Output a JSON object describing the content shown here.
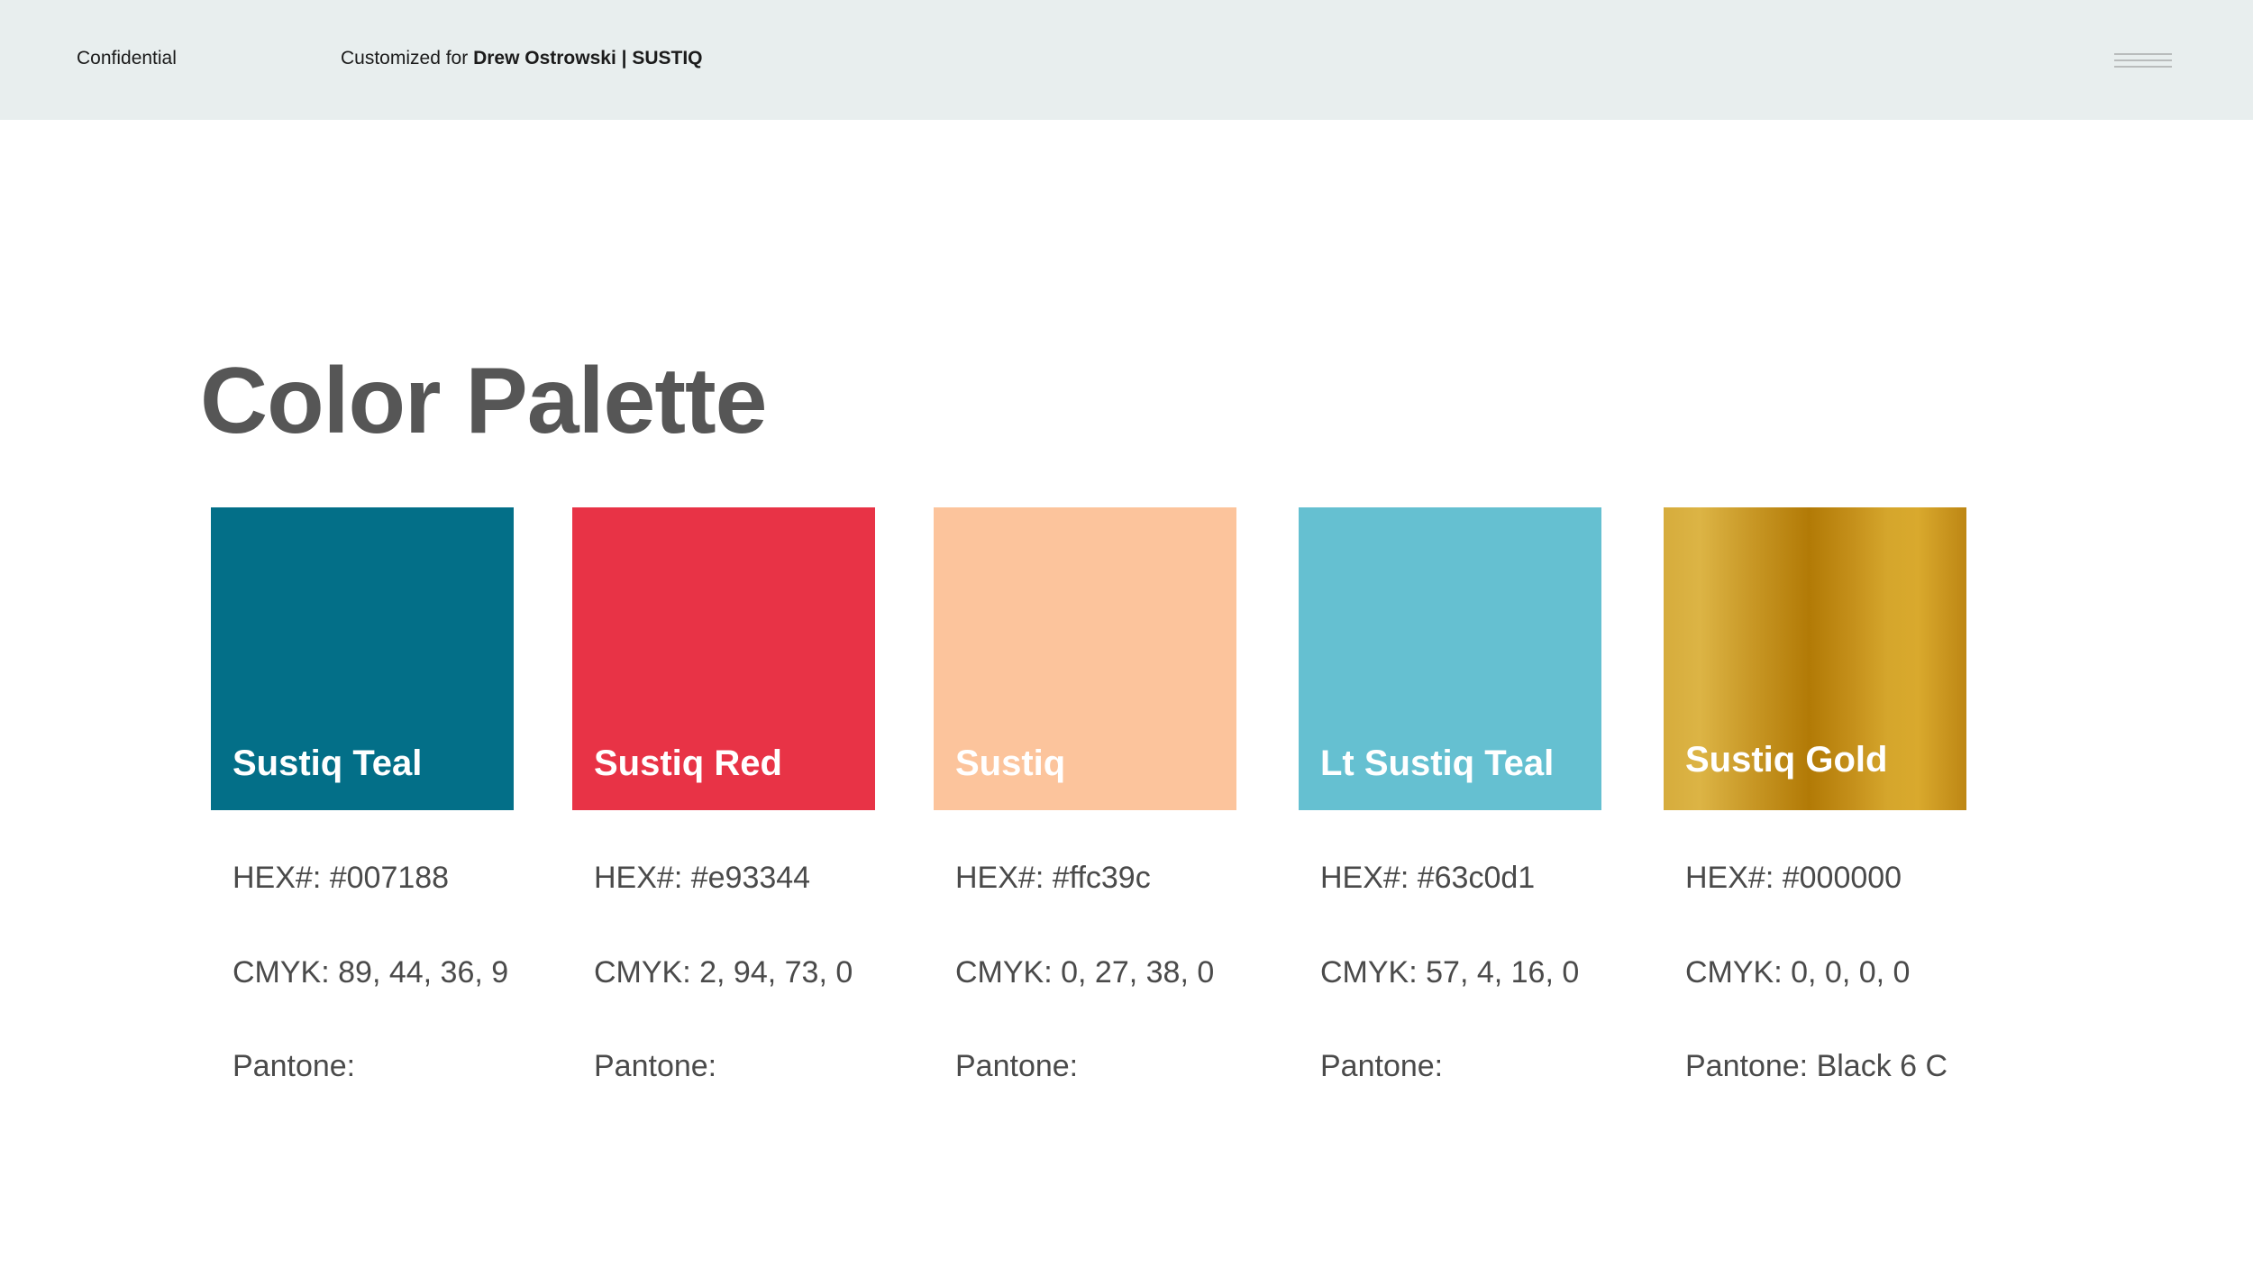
{
  "header": {
    "confidential_label": "Confidential",
    "customized_prefix": "Customized for",
    "customized_for": "Drew Ostrowski | SUSTIQ"
  },
  "page": {
    "title": "Color Palette"
  },
  "swatches": [
    {
      "name": "Sustiq Teal",
      "hex": "HEX#: #007188",
      "cmyk": "CMYK: 89, 44, 36, 9",
      "pantone": "Pantone:",
      "color": "#036f88"
    },
    {
      "name": "Sustiq Red",
      "hex": "HEX#: #e93344",
      "cmyk": "CMYK: 2, 94, 73, 0",
      "pantone": "Pantone:",
      "color": "#e83346"
    },
    {
      "name": "Sustiq",
      "hex": "HEX#: #ffc39c",
      "cmyk": "CMYK: 0, 27, 38, 0",
      "pantone": "Pantone:",
      "color": "#fcc49c"
    },
    {
      "name": "Lt Sustiq Teal",
      "hex": "HEX#: #63c0d1",
      "cmyk": "CMYK: 57, 4, 16, 0",
      "pantone": "Pantone:",
      "color": "#65c0d1"
    },
    {
      "name": "Sustiq Gold",
      "hex": "HEX#: #000000",
      "cmyk": "CMYK: 0, 0, 0, 0",
      "pantone": "Pantone: Black 6 C",
      "color": "#c9971c"
    }
  ],
  "icons": {
    "menu": "hamburger-menu-icon"
  }
}
